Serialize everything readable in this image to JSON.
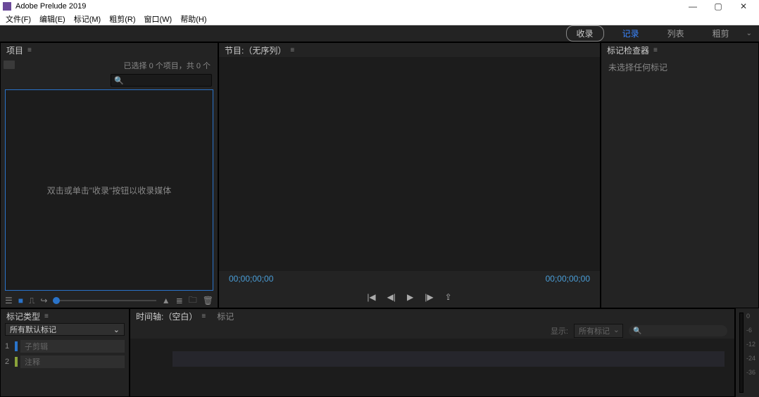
{
  "app": {
    "title": "Adobe Prelude 2019"
  },
  "menu": [
    "文件(F)",
    "编辑(E)",
    "标记(M)",
    "粗剪(R)",
    "窗口(W)",
    "帮助(H)"
  ],
  "workspace_tabs": {
    "ingest": "收录",
    "logging": "记录",
    "list": "列表",
    "roughcut": "粗剪"
  },
  "project": {
    "title": "项目",
    "selection_info": "已选择 0 个项目，共 0 个",
    "empty_hint": "双击或单击\"收录\"按钮以收录媒体"
  },
  "program": {
    "title": "节目:（无序列）",
    "tc_left": "00;00;00;00",
    "tc_right": "00;00;00;00"
  },
  "marker_inspector": {
    "title": "标记检查器",
    "empty": "未选择任何标记"
  },
  "marker_type": {
    "title": "标记类型",
    "select_label": "所有默认标记",
    "rows": [
      {
        "num": "1",
        "color": "#2a73c9",
        "label": "子剪辑"
      },
      {
        "num": "2",
        "color": "#8aa33a",
        "label": "注释"
      }
    ]
  },
  "timeline": {
    "title": "时间轴:（空白）",
    "tab2": "标记",
    "show_label": "显示:",
    "filter_label": "所有标记"
  },
  "vu": {
    "labels": [
      "0",
      "-6",
      "-12",
      "-24",
      "-36"
    ]
  }
}
